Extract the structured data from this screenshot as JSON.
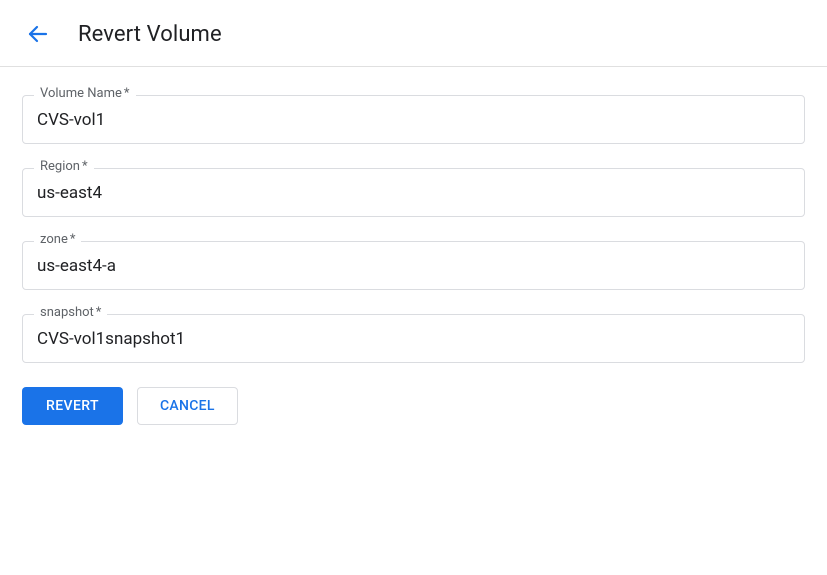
{
  "header": {
    "title": "Revert Volume"
  },
  "fields": {
    "volumeName": {
      "label": "Volume Name",
      "required": "*",
      "value": "CVS-vol1"
    },
    "region": {
      "label": "Region",
      "required": "*",
      "value": "us-east4"
    },
    "zone": {
      "label": "zone",
      "required": "*",
      "value": "us-east4-a"
    },
    "snapshot": {
      "label": "snapshot",
      "required": "*",
      "value": "CVS-vol1snapshot1"
    }
  },
  "actions": {
    "revert": "REVERT",
    "cancel": "CANCEL"
  }
}
